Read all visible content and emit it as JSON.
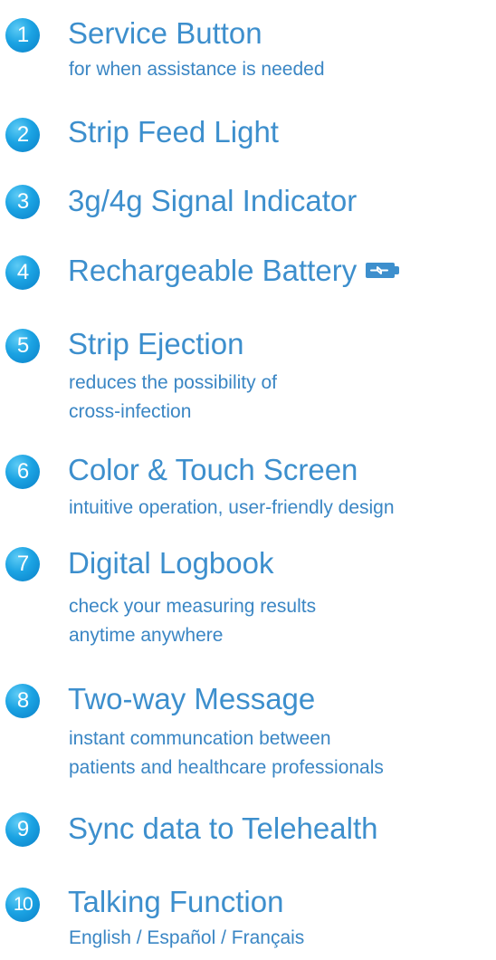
{
  "features": [
    {
      "number": "1",
      "title": "Service Button",
      "description": "for when assistance is needed"
    },
    {
      "number": "2",
      "title": "Strip Feed Light"
    },
    {
      "number": "3",
      "title": "3g/4g Signal Indicator"
    },
    {
      "number": "4",
      "title": "Rechargeable Battery",
      "icon": "battery-charging-icon"
    },
    {
      "number": "5",
      "title": "Strip Ejection",
      "description_lines": [
        "reduces the possibility of",
        "cross-infection"
      ]
    },
    {
      "number": "6",
      "title": "Color & Touch Screen",
      "description": "intuitive operation, user-friendly design"
    },
    {
      "number": "7",
      "title": "Digital Logbook",
      "description_lines": [
        "check your measuring results",
        "anytime anywhere"
      ]
    },
    {
      "number": "8",
      "title": "Two-way Message",
      "description_lines": [
        "instant communcation between",
        "patients and healthcare professionals"
      ]
    },
    {
      "number": "9",
      "title": "Sync data to Telehealth"
    },
    {
      "number": "10",
      "title": "Talking Function",
      "description": "English / Español / Français"
    }
  ],
  "colors": {
    "accent": "#1ba3e3",
    "text": "#3d8fcd"
  }
}
